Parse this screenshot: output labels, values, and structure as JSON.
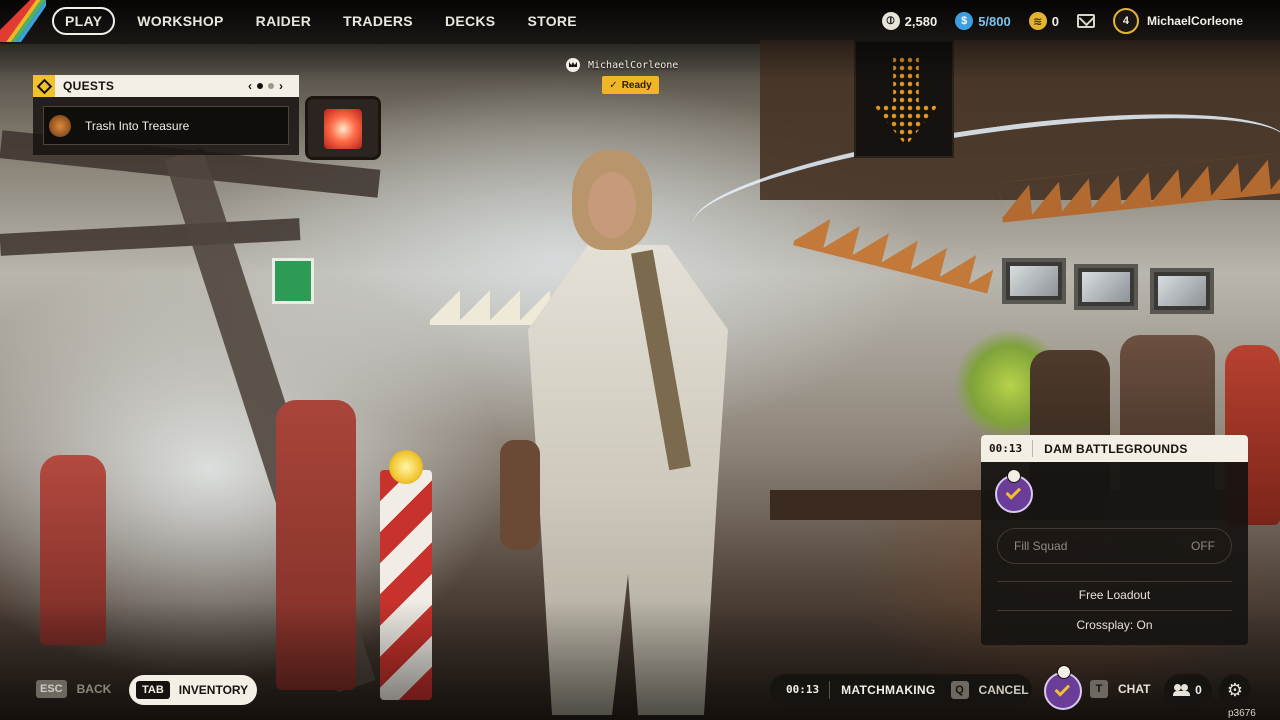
{
  "nav": {
    "items": [
      {
        "label": "PLAY",
        "active": true
      },
      {
        "label": "WORKSHOP",
        "active": false
      },
      {
        "label": "RAIDER",
        "active": false
      },
      {
        "label": "TRADERS",
        "active": false
      },
      {
        "label": "DECKS",
        "active": false
      },
      {
        "label": "STORE",
        "active": false
      }
    ]
  },
  "currencies": {
    "coins": "2,580",
    "credits": "5/800",
    "tokens": "0"
  },
  "profile": {
    "level": "4",
    "name": "MichaelCorleone"
  },
  "quests": {
    "title": "QUESTS",
    "prev_glyph": "‹",
    "next_glyph": "›",
    "items": [
      {
        "label": "Trash Into Treasure"
      }
    ]
  },
  "party": {
    "member_name": "MichaelCorleone",
    "status": "Ready"
  },
  "matchmaking_panel": {
    "timer": "00:13",
    "map": "DAM BATTLEGROUNDS",
    "fill_squad_label": "Fill Squad",
    "fill_squad_value": "OFF",
    "loadout": "Free Loadout",
    "crossplay": "Crossplay: On"
  },
  "bottom": {
    "back_key": "ESC",
    "back_label": "BACK",
    "inventory_key": "TAB",
    "inventory_label": "INVENTORY",
    "mm_timer": "00:13",
    "mm_status": "MATCHMAKING",
    "cancel_key": "Q",
    "cancel_label": "CANCEL",
    "chat_key": "T",
    "chat_label": "CHAT",
    "friends_count": "0",
    "build_id": "p3676"
  },
  "icons": {
    "settings": "gear-icon",
    "friends": "friends-icon",
    "mail": "mail-icon"
  },
  "colors": {
    "accent_yellow": "#f0b625",
    "panel_light": "#f3efe4",
    "panel_dark": "#161311",
    "avatar_purple": "#6a3d99",
    "credits_blue": "#3c9fe0"
  }
}
